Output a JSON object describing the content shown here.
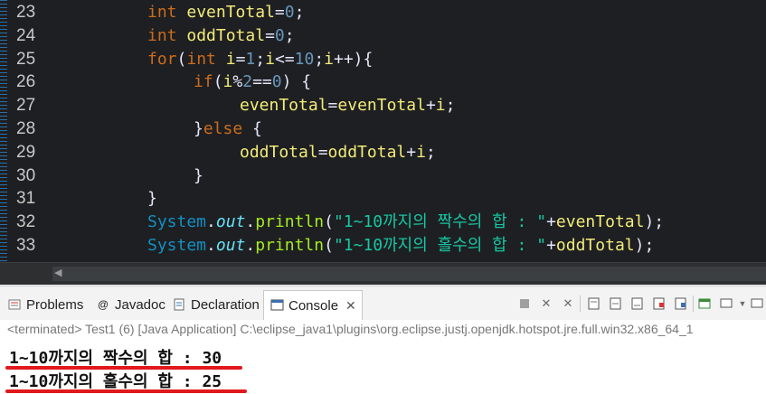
{
  "editor": {
    "lines": [
      {
        "num": "23",
        "tokens": [
          {
            "t": "int",
            "c": "kw"
          },
          {
            "t": " ",
            "c": ""
          },
          {
            "t": "evenTotal",
            "c": "var"
          },
          {
            "t": "=",
            "c": "op"
          },
          {
            "t": "0",
            "c": "num"
          },
          {
            "t": ";",
            "c": "op"
          }
        ],
        "indent": 0
      },
      {
        "num": "24",
        "tokens": [
          {
            "t": "int",
            "c": "kw"
          },
          {
            "t": " ",
            "c": ""
          },
          {
            "t": "oddTotal",
            "c": "var"
          },
          {
            "t": "=",
            "c": "op"
          },
          {
            "t": "0",
            "c": "num"
          },
          {
            "t": ";",
            "c": "op"
          }
        ],
        "indent": 0
      },
      {
        "num": "25",
        "tokens": [
          {
            "t": "for",
            "c": "kw"
          },
          {
            "t": "(",
            "c": "op"
          },
          {
            "t": "int",
            "c": "kw"
          },
          {
            "t": " ",
            "c": ""
          },
          {
            "t": "i",
            "c": "var"
          },
          {
            "t": "=",
            "c": "op"
          },
          {
            "t": "1",
            "c": "num"
          },
          {
            "t": ";",
            "c": "op"
          },
          {
            "t": "i",
            "c": "var"
          },
          {
            "t": "<=",
            "c": "op"
          },
          {
            "t": "10",
            "c": "num"
          },
          {
            "t": ";",
            "c": "op"
          },
          {
            "t": "i",
            "c": "var"
          },
          {
            "t": "++){",
            "c": "op"
          }
        ],
        "indent": 0
      },
      {
        "num": "26",
        "tokens": [
          {
            "t": "if",
            "c": "kw"
          },
          {
            "t": "(",
            "c": "op"
          },
          {
            "t": "i",
            "c": "var"
          },
          {
            "t": "%",
            "c": "op"
          },
          {
            "t": "2",
            "c": "num"
          },
          {
            "t": "==",
            "c": "op"
          },
          {
            "t": "0",
            "c": "num"
          },
          {
            "t": ") {",
            "c": "op"
          }
        ],
        "indent": 1
      },
      {
        "num": "27",
        "tokens": [
          {
            "t": "evenTotal",
            "c": "var"
          },
          {
            "t": "=",
            "c": "op"
          },
          {
            "t": "evenTotal",
            "c": "var"
          },
          {
            "t": "+",
            "c": "op"
          },
          {
            "t": "i",
            "c": "var"
          },
          {
            "t": ";",
            "c": "op"
          }
        ],
        "indent": 2
      },
      {
        "num": "28",
        "tokens": [
          {
            "t": "}",
            "c": "op"
          },
          {
            "t": "else",
            "c": "kw"
          },
          {
            "t": " {",
            "c": "op"
          }
        ],
        "indent": 1
      },
      {
        "num": "29",
        "tokens": [
          {
            "t": "oddTotal",
            "c": "var"
          },
          {
            "t": "=",
            "c": "op"
          },
          {
            "t": "oddTotal",
            "c": "var"
          },
          {
            "t": "+",
            "c": "op"
          },
          {
            "t": "i",
            "c": "var"
          },
          {
            "t": ";",
            "c": "op"
          }
        ],
        "indent": 2
      },
      {
        "num": "30",
        "tokens": [
          {
            "t": "}",
            "c": "op"
          }
        ],
        "indent": 1
      },
      {
        "num": "31",
        "tokens": [
          {
            "t": "}",
            "c": "op"
          }
        ],
        "indent": 0
      },
      {
        "num": "32",
        "tokens": [
          {
            "t": "System",
            "c": "cls"
          },
          {
            "t": ".",
            "c": "op"
          },
          {
            "t": "out",
            "c": "fld"
          },
          {
            "t": ".",
            "c": "op"
          },
          {
            "t": "println",
            "c": "mth"
          },
          {
            "t": "(",
            "c": "op"
          },
          {
            "t": "\"1~10까지의 짝수의 합 : \"",
            "c": "str"
          },
          {
            "t": "+",
            "c": "op"
          },
          {
            "t": "evenTotal",
            "c": "var"
          },
          {
            "t": ");",
            "c": "op"
          }
        ],
        "indent": 0
      },
      {
        "num": "33",
        "tokens": [
          {
            "t": "System",
            "c": "cls"
          },
          {
            "t": ".",
            "c": "op"
          },
          {
            "t": "out",
            "c": "fld"
          },
          {
            "t": ".",
            "c": "op"
          },
          {
            "t": "println",
            "c": "mth"
          },
          {
            "t": "(",
            "c": "op"
          },
          {
            "t": "\"1~10까지의 홀수의 합 : \"",
            "c": "str"
          },
          {
            "t": "+",
            "c": "op"
          },
          {
            "t": "oddTotal",
            "c": "var"
          },
          {
            "t": ");",
            "c": "op"
          }
        ],
        "indent": 0
      }
    ]
  },
  "tabs": {
    "problems": "Problems",
    "javadoc": "Javadoc",
    "declaration": "Declaration",
    "console": "Console",
    "close_glyph": "✕"
  },
  "console": {
    "status": "<terminated> Test1 (6) [Java Application] C:\\eclipse_java1\\plugins\\org.eclipse.justj.openjdk.hotspot.jre.full.win32.x86_64_1",
    "output": [
      "1~10까지의 짝수의 합 : 30",
      "1~10까지의 홀수의 합 : 25"
    ]
  },
  "icons": {
    "problems": "problems-icon",
    "javadoc": "javadoc-icon",
    "declaration": "declaration-icon",
    "console": "console-icon"
  },
  "colors": {
    "editor_bg": "#1e1f22",
    "keyword": "#cc6c1d",
    "variable": "#f3ec79",
    "number": "#6897bb",
    "string": "#17c6a3",
    "highlight_underline": "#e0191c"
  }
}
